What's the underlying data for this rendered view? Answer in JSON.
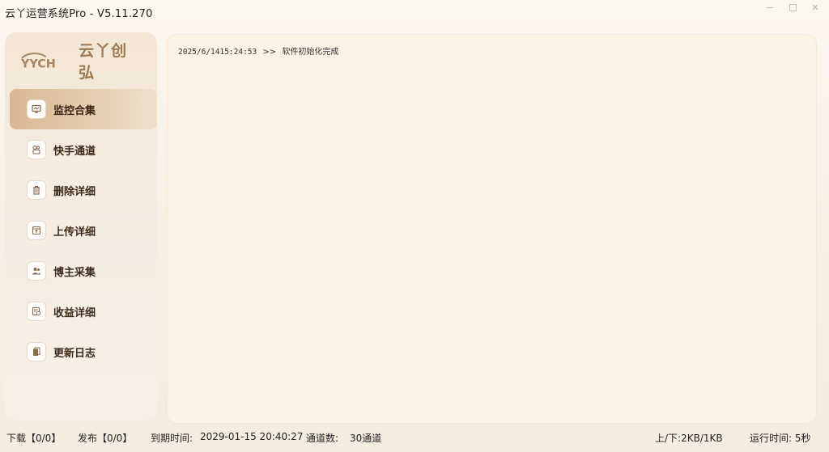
{
  "window": {
    "title": "云丫运营系统Pro - V5.11.270"
  },
  "logo": {
    "mark_text": "YYCH",
    "brand_text": "云丫创弘"
  },
  "sidebar": {
    "items": [
      {
        "label": "监控合集",
        "icon": "monitor-icon",
        "active": true
      },
      {
        "label": "快手通道",
        "icon": "channel-icon",
        "active": false
      },
      {
        "label": "删除详细",
        "icon": "trash-icon",
        "active": false
      },
      {
        "label": "上传详细",
        "icon": "upload-icon",
        "active": false
      },
      {
        "label": "博主采集",
        "icon": "users-icon",
        "active": false
      },
      {
        "label": "收益详细",
        "icon": "revenue-icon",
        "active": false
      },
      {
        "label": "更新日志",
        "icon": "log-icon",
        "active": false
      }
    ]
  },
  "log": {
    "entries": [
      {
        "timestamp": "2025/6/1415:24:53",
        "separator": ">>",
        "message": "软件初始化完成"
      }
    ]
  },
  "status": {
    "download": "下载【0/0】",
    "publish": "发布【0/0】",
    "expire_label": "到期时间:",
    "expire_value": "2029-01-15 20:40:27",
    "channels_label": "通道数:",
    "channels_value": "30通道",
    "traffic": "上/下:2KB/1KB",
    "runtime": "运行时间: 5秒"
  },
  "colors": {
    "accent": "#d8b892",
    "panel_bg": "#fdf2e3",
    "brand": "#9c7a55"
  }
}
